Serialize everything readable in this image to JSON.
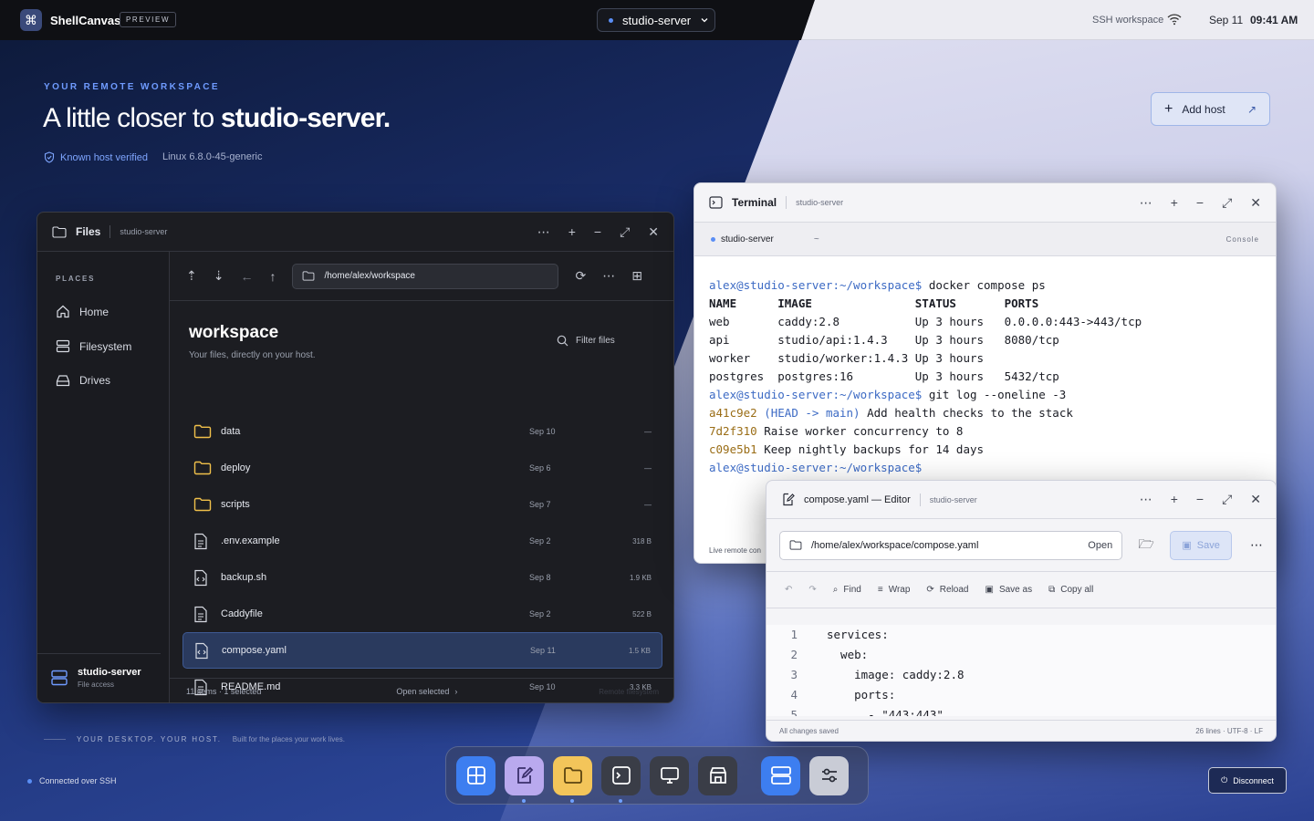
{
  "app": {
    "name": "ShellCanvas",
    "badge": "PREVIEW"
  },
  "topbar": {
    "server": "studio-server",
    "workspace_label": "SSH workspace",
    "date": "Sep 11",
    "time": "09:41 AM"
  },
  "hero": {
    "eyebrow": "YOUR REMOTE WORKSPACE",
    "headline_prefix": "A little closer to ",
    "headline_host": "studio-server.",
    "verified": "Known host verified",
    "kernel": "Linux 6.8.0-45-generic",
    "add_host": "Add host"
  },
  "files": {
    "title": "Files",
    "host": "studio-server",
    "places_label": "PLACES",
    "places": [
      {
        "label": "Home",
        "icon": "home-icon"
      },
      {
        "label": "Filesystem",
        "icon": "filesystem-icon"
      },
      {
        "label": "Drives",
        "icon": "drive-icon"
      }
    ],
    "footer_host": "studio-server",
    "footer_sub": "File access",
    "path": "/home/alex/workspace",
    "folder_title": "workspace",
    "folder_sub": "Your files, directly on your host.",
    "filter": "Filter files",
    "rows": [
      {
        "name": "data",
        "date": "Sep 10",
        "size": "—",
        "type": "folder"
      },
      {
        "name": "deploy",
        "date": "Sep 6",
        "size": "—",
        "type": "folder"
      },
      {
        "name": "scripts",
        "date": "Sep 7",
        "size": "—",
        "type": "folder"
      },
      {
        "name": ".env.example",
        "date": "Sep 2",
        "size": "318 B",
        "type": "doc"
      },
      {
        "name": "backup.sh",
        "date": "Sep 8",
        "size": "1.9 KB",
        "type": "code"
      },
      {
        "name": "Caddyfile",
        "date": "Sep 2",
        "size": "522 B",
        "type": "doc"
      },
      {
        "name": "compose.yaml",
        "date": "Sep 11",
        "size": "1.5 KB",
        "type": "code"
      },
      {
        "name": "README.md",
        "date": "Sep 10",
        "size": "3.3 KB",
        "type": "doc"
      }
    ],
    "status": "11 items · 1 selected",
    "open_selected": "Open selected",
    "remote": "Remote filesystem"
  },
  "terminal": {
    "title": "Terminal",
    "host": "studio-server",
    "tab": "studio-server",
    "tab_path": "~",
    "console": "Console",
    "prompt": "alex@studio-server:~/workspace$",
    "cmd1": " docker compose ps",
    "header": "NAME      IMAGE               STATUS       PORTS",
    "ps_rows": [
      "web       caddy:2.8           Up 3 hours   0.0.0.0:443->443/tcp",
      "api       studio/api:1.4.3    Up 3 hours   8080/tcp",
      "worker    studio/worker:1.4.3 Up 3 hours",
      "postgres  postgres:16         Up 3 hours   5432/tcp"
    ],
    "cmd2": " git log --oneline -3",
    "log": [
      {
        "hash": "a41c9e2",
        "ref": " (HEAD -> main)",
        "msg": " Add health checks to the stack"
      },
      {
        "hash": "7d2f310",
        "ref": "",
        "msg": " Raise worker concurrency to 8"
      },
      {
        "hash": "c09e5b1",
        "ref": "",
        "msg": " Keep nightly backups for 14 days"
      }
    ],
    "footer": "Live remote con"
  },
  "editor": {
    "title": "compose.yaml — Editor",
    "host": "studio-server",
    "path": "/home/alex/workspace/compose.yaml",
    "open": "Open",
    "save": "Save",
    "tools": [
      "Find",
      "Wrap",
      "Reload",
      "Save as",
      "Copy all"
    ],
    "lines": [
      "services:",
      "  web:",
      "    image: caddy:2.8",
      "    ports:",
      "      - \"443:443\""
    ],
    "status": "All changes saved",
    "meta": "26 lines · UTF-8 · LF"
  },
  "footer": {
    "tagline": "YOUR DESKTOP. YOUR HOST.",
    "tagline_sub": "Built for the places your work lives.",
    "connection": "Connected over SSH",
    "disconnect": "Disconnect"
  },
  "dock": [
    {
      "icon": "grid-icon",
      "color": "#3d7ef0"
    },
    {
      "icon": "editor-icon",
      "color": "#b9a9ee"
    },
    {
      "icon": "folder-icon",
      "color": "#f3c55a"
    },
    {
      "icon": "terminal-icon",
      "color": "#3a3d47"
    },
    {
      "icon": "remote-desktop-icon",
      "color": "#3a3d47"
    },
    {
      "icon": "store-icon",
      "color": "#3a3d47"
    },
    {
      "icon": "server-icon",
      "color": "#3d7ef0"
    },
    {
      "icon": "settings-icon",
      "color": "#c9ccd6"
    }
  ]
}
